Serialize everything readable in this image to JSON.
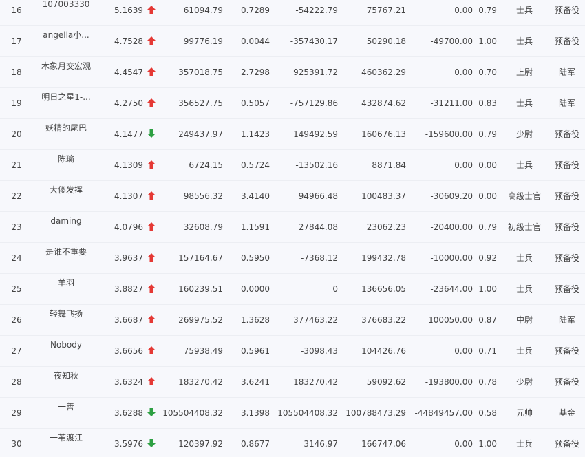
{
  "colors": {
    "up": "#e53935",
    "down": "#2ea043",
    "text": "#444444",
    "background": "#f7f8fc"
  },
  "rows": [
    {
      "rank": "16",
      "name": "107003330",
      "score": "5.1639",
      "trend": "up",
      "a": "61094.79",
      "b": "0.7289",
      "c": "-54222.79",
      "d": "75767.21",
      "e": "0.00",
      "f": "0.79",
      "rank_name": "士兵",
      "type": "预备役"
    },
    {
      "rank": "17",
      "name": "angella小...",
      "score": "4.7528",
      "trend": "up",
      "a": "99776.19",
      "b": "0.0044",
      "c": "-357430.17",
      "d": "50290.18",
      "e": "-49700.00",
      "f": "1.00",
      "rank_name": "士兵",
      "type": "预备役"
    },
    {
      "rank": "18",
      "name": "木象月交宏观",
      "score": "4.4547",
      "trend": "up",
      "a": "357018.75",
      "b": "2.7298",
      "c": "925391.72",
      "d": "460362.29",
      "e": "0.00",
      "f": "0.70",
      "rank_name": "上尉",
      "type": "陆军"
    },
    {
      "rank": "19",
      "name": "明日之星1-...",
      "score": "4.2750",
      "trend": "up",
      "a": "356527.75",
      "b": "0.5057",
      "c": "-757129.86",
      "d": "432874.62",
      "e": "-31211.00",
      "f": "0.83",
      "rank_name": "士兵",
      "type": "陆军"
    },
    {
      "rank": "20",
      "name": "妖精的尾巴",
      "score": "4.1477",
      "trend": "down",
      "a": "249437.97",
      "b": "1.1423",
      "c": "149492.59",
      "d": "160676.13",
      "e": "-159600.00",
      "f": "0.79",
      "rank_name": "少尉",
      "type": "预备役"
    },
    {
      "rank": "21",
      "name": "陈瑜",
      "score": "4.1309",
      "trend": "up",
      "a": "6724.15",
      "b": "0.5724",
      "c": "-13502.16",
      "d": "8871.84",
      "e": "0.00",
      "f": "0.00",
      "rank_name": "士兵",
      "type": "预备役"
    },
    {
      "rank": "22",
      "name": "大傻发挥",
      "score": "4.1307",
      "trend": "up",
      "a": "98556.32",
      "b": "3.4140",
      "c": "94966.48",
      "d": "100483.37",
      "e": "-30609.20",
      "f": "0.00",
      "rank_name": "高级士官",
      "type": "预备役"
    },
    {
      "rank": "23",
      "name": "daming",
      "score": "4.0796",
      "trend": "up",
      "a": "32608.79",
      "b": "1.1591",
      "c": "27844.08",
      "d": "23062.23",
      "e": "-20400.00",
      "f": "0.79",
      "rank_name": "初级士官",
      "type": "预备役"
    },
    {
      "rank": "24",
      "name": "是谁不重要",
      "score": "3.9637",
      "trend": "up",
      "a": "157164.67",
      "b": "0.5950",
      "c": "-7368.12",
      "d": "199432.78",
      "e": "-10000.00",
      "f": "0.92",
      "rank_name": "士兵",
      "type": "预备役"
    },
    {
      "rank": "25",
      "name": "羊羽",
      "score": "3.8827",
      "trend": "up",
      "a": "160239.51",
      "b": "0.0000",
      "c": "0",
      "d": "136656.05",
      "e": "-23644.00",
      "f": "1.00",
      "rank_name": "士兵",
      "type": "预备役"
    },
    {
      "rank": "26",
      "name": "轻舞飞扬",
      "score": "3.6687",
      "trend": "up",
      "a": "269975.52",
      "b": "1.3628",
      "c": "377463.22",
      "d": "376683.22",
      "e": "100050.00",
      "f": "0.87",
      "rank_name": "中尉",
      "type": "陆军"
    },
    {
      "rank": "27",
      "name": "Nobody",
      "score": "3.6656",
      "trend": "up",
      "a": "75938.49",
      "b": "0.5961",
      "c": "-3098.43",
      "d": "104426.76",
      "e": "0.00",
      "f": "0.71",
      "rank_name": "士兵",
      "type": "预备役"
    },
    {
      "rank": "28",
      "name": "夜知秋",
      "score": "3.6324",
      "trend": "up",
      "a": "183270.42",
      "b": "3.6241",
      "c": "183270.42",
      "d": "59092.62",
      "e": "-193800.00",
      "f": "0.78",
      "rank_name": "少尉",
      "type": "预备役"
    },
    {
      "rank": "29",
      "name": "一善",
      "score": "3.6288",
      "trend": "down",
      "a": "105504408.32",
      "b": "3.1398",
      "c": "105504408.32",
      "d": "100788473.29",
      "e": "-44849457.00",
      "f": "0.58",
      "rank_name": "元帅",
      "type": "基金"
    },
    {
      "rank": "30",
      "name": "一苇渡江",
      "score": "3.5976",
      "trend": "down",
      "a": "120397.92",
      "b": "0.8677",
      "c": "3146.97",
      "d": "166747.06",
      "e": "0.00",
      "f": "1.00",
      "rank_name": "士兵",
      "type": "预备役"
    }
  ]
}
